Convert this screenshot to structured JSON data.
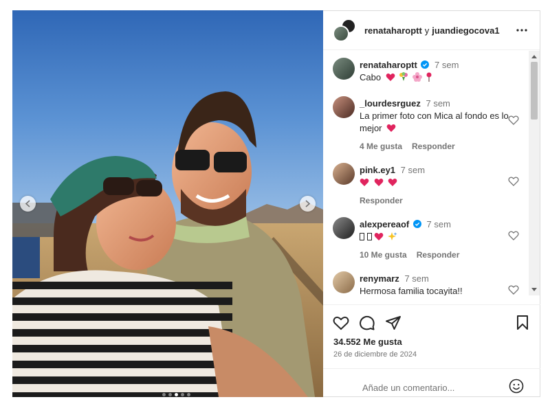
{
  "header": {
    "user1": "renataharoptt",
    "conjunction": "y",
    "user2": "juandiegocova1",
    "more_icon": "more-horizontal-icon"
  },
  "caption": {
    "username": "renataharoptt",
    "verified": true,
    "time": "7 sem",
    "text": "Cabo"
  },
  "comments": [
    {
      "username": "_lourdesrguez",
      "verified": false,
      "time": "7 sem",
      "text": "La primer foto con Mica al fondo es lo mejor",
      "likes": "4 Me gusta",
      "reply": "Responder"
    },
    {
      "username": "pink.ey1",
      "verified": false,
      "time": "7 sem",
      "text": "",
      "likes": "",
      "reply": "Responder"
    },
    {
      "username": "alexpereaof",
      "verified": true,
      "time": "7 sem",
      "text": "",
      "likes": "10 Me gusta",
      "reply": "Responder"
    },
    {
      "username": "renymarz",
      "verified": false,
      "time": "7 sem",
      "text": "Hermosa familia tocayita!!",
      "likes": "",
      "reply": ""
    }
  ],
  "post": {
    "likes": "34.552 Me gusta",
    "date": "26 de diciembre de 2024",
    "add_comment_placeholder": "Añade un comentario..."
  },
  "colors": {
    "heart_red": "#e0245e",
    "verified_blue": "#0095f6",
    "muted_text": "#737373"
  },
  "carousel": {
    "slides": 5,
    "active": 2
  }
}
